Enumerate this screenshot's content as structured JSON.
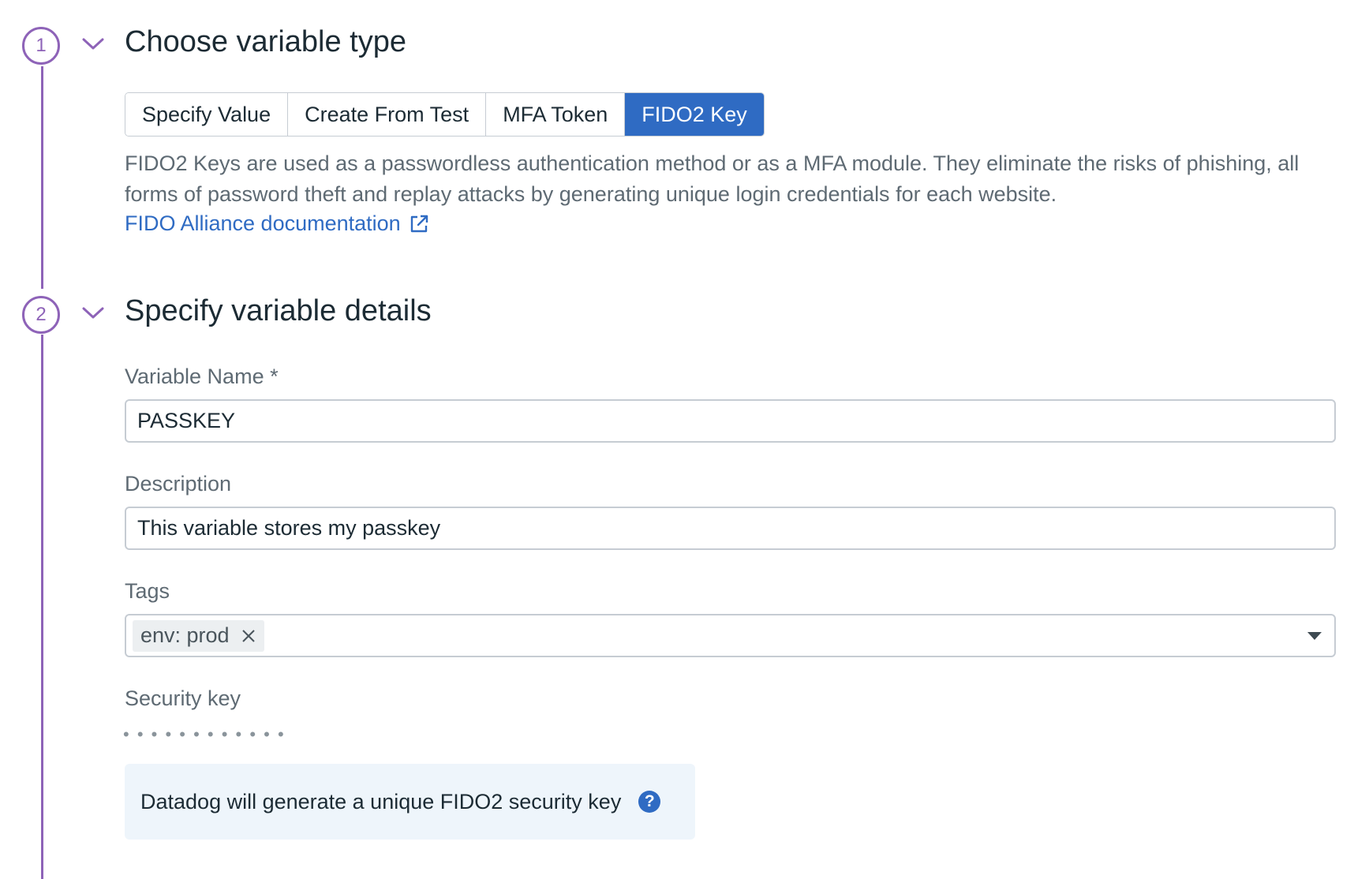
{
  "steps": [
    {
      "number": "1",
      "title": "Choose variable type"
    },
    {
      "number": "2",
      "title": "Specify variable details"
    }
  ],
  "variable_type": {
    "options": [
      "Specify Value",
      "Create From Test",
      "MFA Token",
      "FIDO2 Key"
    ],
    "selected": "FIDO2 Key",
    "description": "FIDO2 Keys are used as a passwordless authentication method or as a MFA module. They eliminate the risks of phishing, all forms of password theft and replay attacks by generating unique login credentials for each website.",
    "doc_link": "FIDO Alliance documentation"
  },
  "details": {
    "name_label": "Variable Name *",
    "name_value": "PASSKEY",
    "description_label": "Description",
    "description_value": "This variable stores my passkey",
    "tags_label": "Tags",
    "tags": [
      "env: prod"
    ],
    "security_key_label": "Security key",
    "security_key_mask": "• • • • • • • • • • • •",
    "info_text": "Datadog will generate a unique FIDO2 security key"
  },
  "colors": {
    "accent": "#8e63b8",
    "primary": "#2f6bc3",
    "info_bg": "#eef5fb"
  }
}
